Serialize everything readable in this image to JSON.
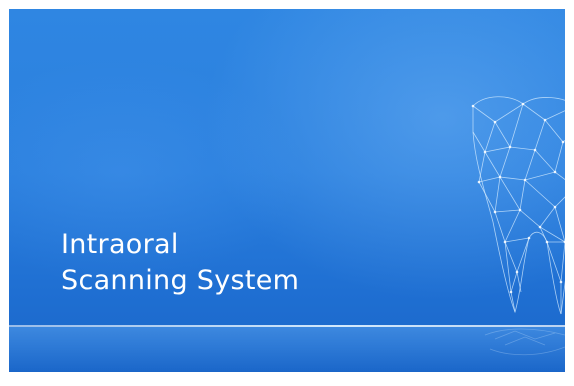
{
  "splash": {
    "title_line1": "Intraoral",
    "title_line2": "Scanning System"
  },
  "colors": {
    "background_top": "#2f86e2",
    "background_bottom": "#1a66c9",
    "text": "#ffffff",
    "wireframe": "#d6ecff"
  },
  "icons": {
    "logo": "tooth-wireframe-icon"
  }
}
